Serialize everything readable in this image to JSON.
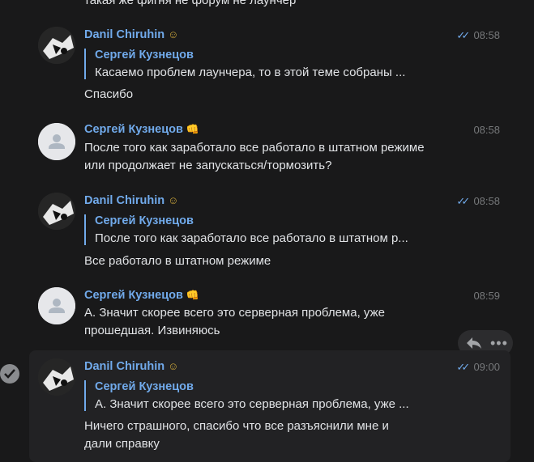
{
  "top_fragment": "такая же фигня не форум не лаунчер",
  "messages": [
    {
      "author": "Danil Chiruhin",
      "emoji": "☺",
      "time": "08:58",
      "read": true,
      "reply": {
        "author": "Сергей Кузнецов",
        "text": "Касаемо проблем лаунчера, то в этой теме собраны ..."
      },
      "text_lines": [
        "Спасибо"
      ]
    },
    {
      "author": "Сергей Кузнецов",
      "emoji": "👊",
      "time": "08:58",
      "read": false,
      "text_lines": [
        "После того как заработало все работало в штатном режиме",
        "или продолжает не запускаться/тормозить?"
      ]
    },
    {
      "author": "Danil Chiruhin",
      "emoji": "☺",
      "time": "08:58",
      "read": true,
      "reply": {
        "author": "Сергей Кузнецов",
        "text": "После того как заработало все работало в штатном р..."
      },
      "text_lines": [
        "Все работало в штатном режиме"
      ]
    },
    {
      "author": "Сергей Кузнецов",
      "emoji": "👊",
      "time": "08:59",
      "read": false,
      "text_lines": [
        "А. Значит скорее всего это серверная проблема, уже",
        "прошедшая. Извиняюсь"
      ]
    },
    {
      "author": "Danil Chiruhin",
      "emoji": "☺",
      "time": "09:00",
      "read": true,
      "selected": true,
      "reply": {
        "author": "Сергей Кузнецов",
        "text": "А. Значит скорее всего это серверная проблема, уже ..."
      },
      "text_lines": [
        "Ничего страшного, спасибо что все разъяснили мне и",
        "дали справку"
      ]
    }
  ],
  "actions": {
    "reply_icon": "reply-arrow-icon",
    "more_icon": "more-dots-icon",
    "more_glyph": "•••"
  },
  "colors": {
    "background": "#19191a",
    "accent": "#71aaeb",
    "text": "#e1e3e6",
    "muted": "#76787a",
    "selected_bg": "#222224"
  }
}
